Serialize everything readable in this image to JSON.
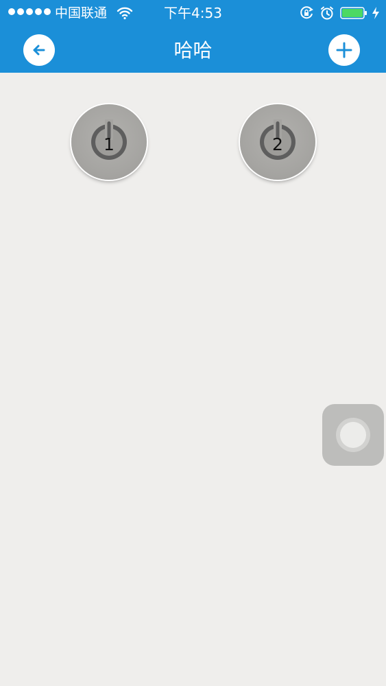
{
  "status_bar": {
    "carrier": "中国联通",
    "time": "下午4:53",
    "signal_dots": 5,
    "icons": [
      "wifi-icon",
      "rotation-lock-icon",
      "alarm-icon",
      "battery-icon",
      "charging-icon"
    ],
    "battery_color": "#4cd964"
  },
  "nav": {
    "title": "哈哈",
    "back_icon": "arrow-left-icon",
    "add_icon": "plus-icon",
    "bar_color": "#1b8fd8"
  },
  "switches": [
    {
      "label": "1",
      "icon": "power-icon"
    },
    {
      "label": "2",
      "icon": "power-icon"
    }
  ],
  "assistive_touch": {
    "icon": "assistive-touch-icon"
  }
}
